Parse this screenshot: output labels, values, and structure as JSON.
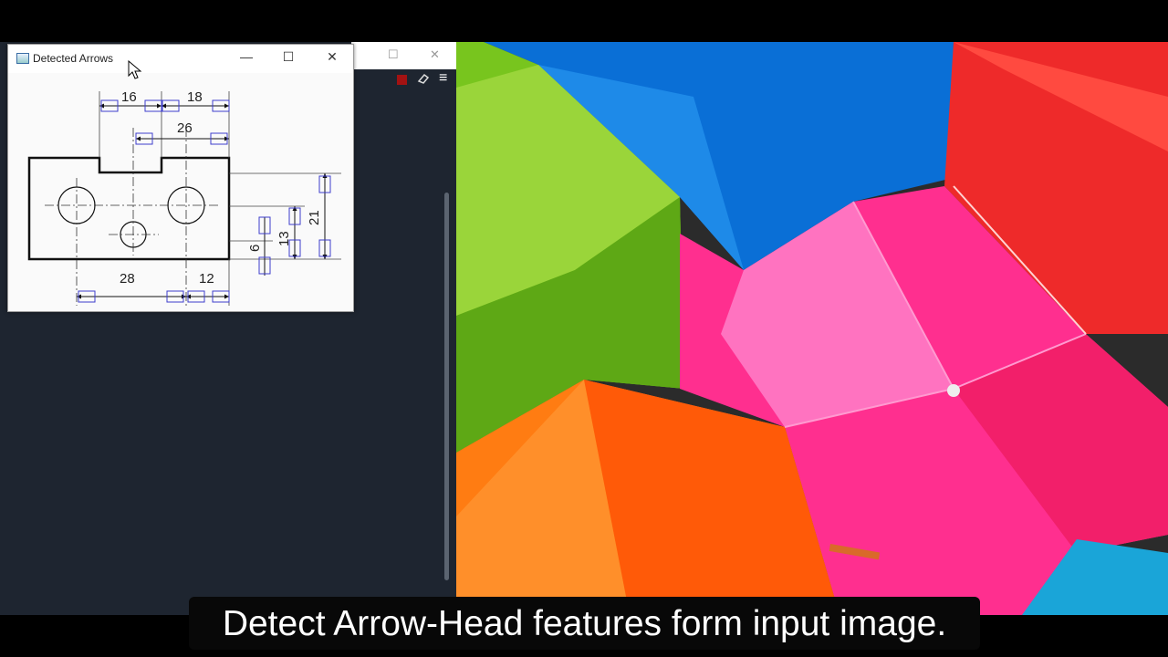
{
  "detected_window": {
    "title": "Detected Arrows",
    "controls": {
      "minimize": "—",
      "maximize": "☐",
      "close": "✕"
    },
    "drawing": {
      "dimensions": [
        "16",
        "18",
        "26",
        "21",
        "13",
        "6",
        "28",
        "12"
      ]
    }
  },
  "background_app": {
    "controls": {
      "maximize": "☐",
      "close": "✕"
    },
    "menu_icon": "≡",
    "tools": [
      "stop-icon",
      "eraser-icon",
      "menu-icon"
    ]
  },
  "caption": {
    "text": "Detect Arrow-Head features form input image."
  },
  "colors": {
    "arrow_box": "#3d3dcc",
    "drawing_line": "#111111",
    "dark_bg": "#1e2530"
  }
}
